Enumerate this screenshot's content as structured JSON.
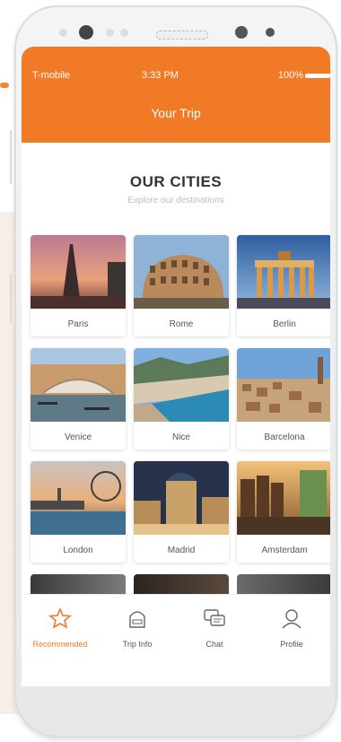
{
  "status": {
    "carrier": "T-mobile",
    "time": "3:33 PM",
    "battery": "100%"
  },
  "app": {
    "title": "Your Trip"
  },
  "section": {
    "heading": "OUR CITIES",
    "subheading": "Explore our destinations"
  },
  "cities": [
    {
      "name": "Paris"
    },
    {
      "name": "Rome"
    },
    {
      "name": "Berlin"
    },
    {
      "name": "Venice"
    },
    {
      "name": "Nice"
    },
    {
      "name": "Barcelona"
    },
    {
      "name": "London"
    },
    {
      "name": "Madrid"
    },
    {
      "name": "Amsterdam"
    }
  ],
  "tabs": [
    {
      "label": "Recommended",
      "icon": "star-icon",
      "active": true
    },
    {
      "label": "Trip Info",
      "icon": "bag-icon",
      "active": false
    },
    {
      "label": "Chat",
      "icon": "chat-icon",
      "active": false
    },
    {
      "label": "Profile",
      "icon": "profile-icon",
      "active": false
    }
  ],
  "colors": {
    "accent": "#f07a25"
  }
}
